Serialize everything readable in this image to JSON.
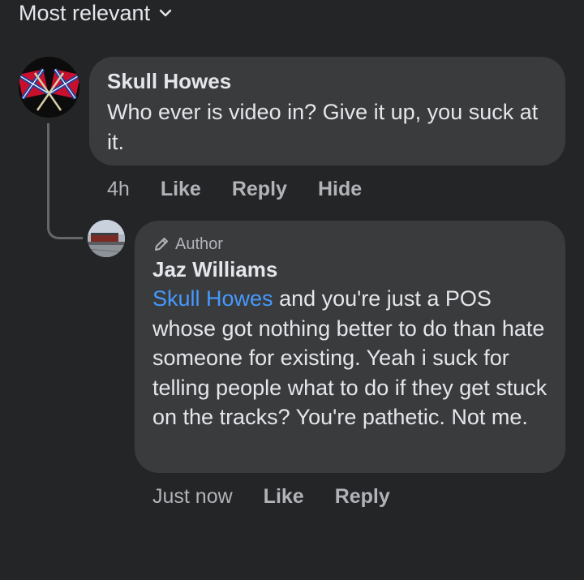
{
  "sort": {
    "label": "Most relevant"
  },
  "comments": [
    {
      "author": "Skull Howes",
      "text": "Who ever is video in? Give it up, you suck at it.",
      "time": "4h",
      "actions": [
        "Like",
        "Reply",
        "Hide"
      ]
    },
    {
      "badge": "Author",
      "author": "Jaz Williams",
      "mention": "Skull Howes",
      "text": " and you're just a POS whose got nothing better to do than hate someone for existing. Yeah i suck for telling people what to do if they get stuck on the tracks? You're pathetic. Not me.",
      "time": "Just now",
      "actions": [
        "Like",
        "Reply"
      ]
    }
  ],
  "colors": {
    "background": "#242526",
    "bubble": "#3a3b3c",
    "primary_text": "#e4e6eb",
    "secondary_text": "#b0b3b8",
    "mention": "#4599ff"
  },
  "icons": {
    "sort": "chevron-down-icon",
    "badge": "pencil-icon"
  }
}
